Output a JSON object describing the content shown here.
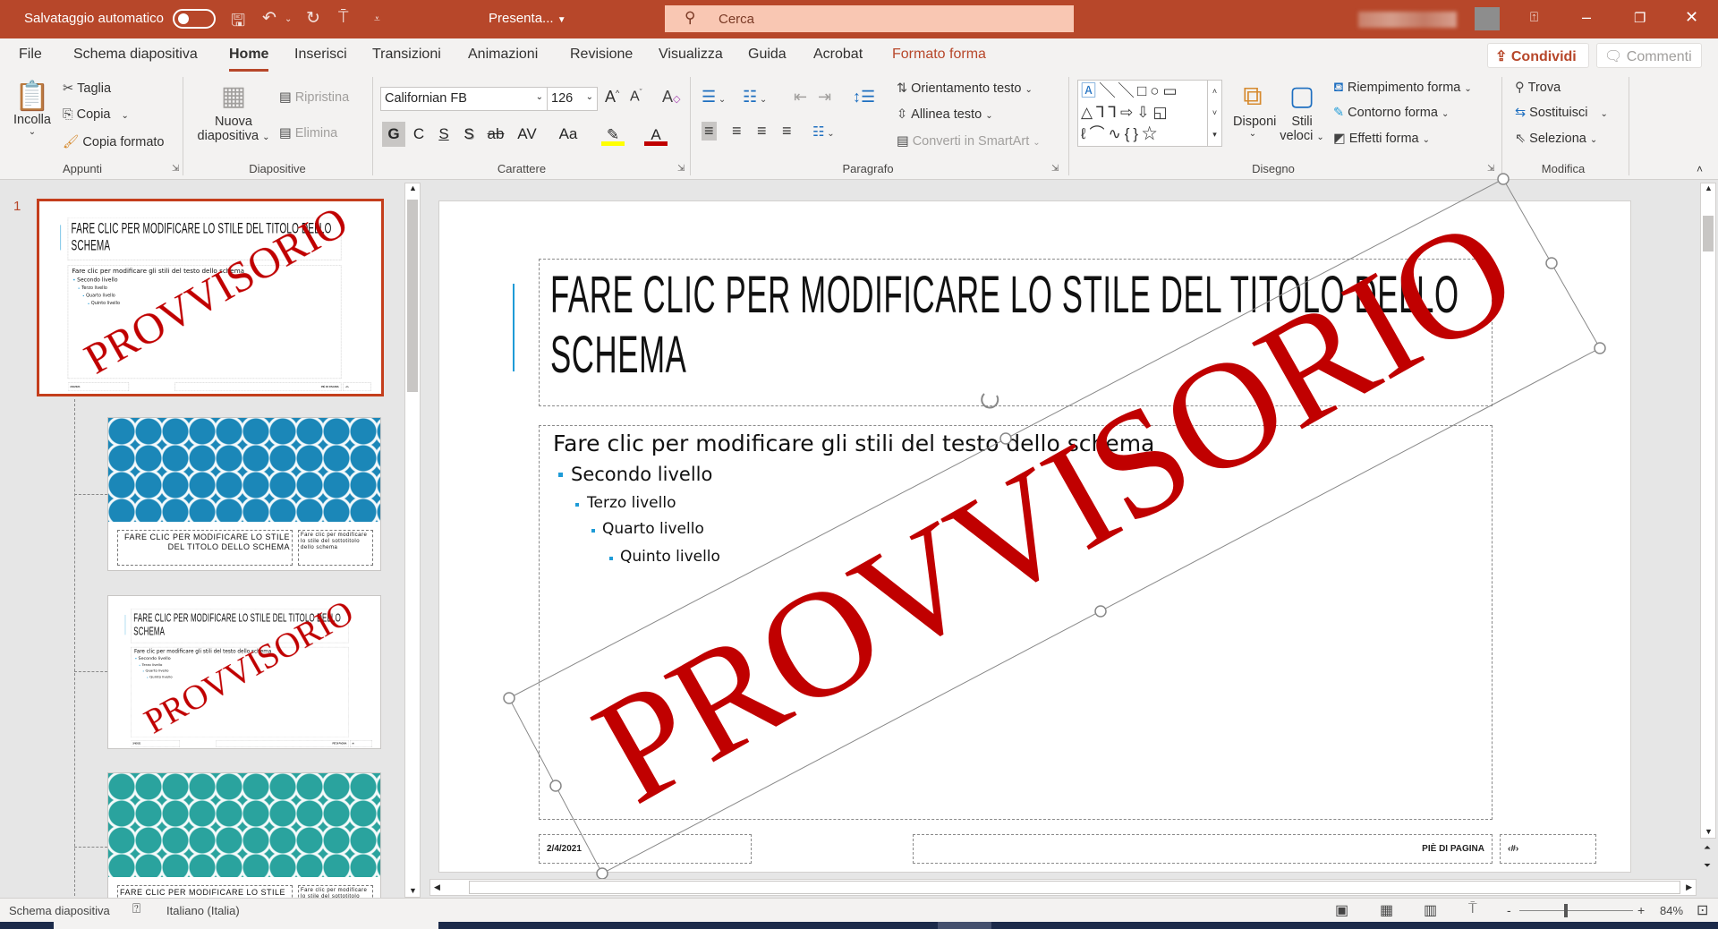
{
  "titlebar": {
    "autosave_label": "Salvataggio automatico",
    "file_name": "Presenta...",
    "search_placeholder": "Cerca",
    "accent": "#b7472a"
  },
  "menu": {
    "tabs": [
      "File",
      "Schema diapositiva",
      "Home",
      "Inserisci",
      "Transizioni",
      "Animazioni",
      "Revisione",
      "Visualizza",
      "Guida",
      "Acrobat",
      "Formato forma"
    ],
    "active": "Home",
    "share": "Condividi",
    "comments": "Commenti"
  },
  "ribbon": {
    "appunti": {
      "label": "Appunti",
      "paste": "Incolla",
      "cut": "Taglia",
      "copy": "Copia",
      "format_painter": "Copia formato"
    },
    "diapositive": {
      "label": "Diapositive",
      "new_slide_1": "Nuova",
      "new_slide_2": "diapositiva",
      "reset": "Ripristina",
      "delete": "Elimina"
    },
    "carattere": {
      "label": "Carattere",
      "font": "Californian FB",
      "size": "126",
      "bold": "G",
      "italic": "C",
      "underline": "S",
      "shadow": "S",
      "strike": "ab",
      "spacing": "AV",
      "case": "Aa"
    },
    "paragrafo": {
      "label": "Paragrafo",
      "text_direction": "Orientamento testo",
      "align_text": "Allinea testo",
      "smartart": "Converti in SmartArt"
    },
    "disegno": {
      "label": "Disegno",
      "arrange": "Disponi",
      "quick_styles_1": "Stili",
      "quick_styles_2": "veloci",
      "fill": "Riempimento forma",
      "outline": "Contorno forma",
      "effects": "Effetti forma"
    },
    "modifica": {
      "label": "Modifica",
      "find": "Trova",
      "replace": "Sostituisci",
      "select": "Seleziona"
    }
  },
  "thumbnails": {
    "selected_number": "1",
    "layout_title": "FARE CLIC PER MODIFICARE LO STILE DEL TITOLO DELLO SCHEMA",
    "layout_title_short": "FARE CLIC PER MODIFICARE LO STILE",
    "layout_text": "Fare clic per modificare lo stile del sottotitolo dello schema",
    "colors": {
      "blue": "#1b87b8",
      "teal": "#2aa39e"
    }
  },
  "slide": {
    "title": "FARE CLIC PER MODIFICARE LO STILE DEL TITOLO DELLO SCHEMA",
    "body": {
      "level1": "Fare clic per modificare gli stili del testo dello schema",
      "level2": "Secondo livello",
      "level3": "Terzo livello",
      "level4": "Quarto livello",
      "level5": "Quinto livello"
    },
    "watermark": "PROVVISORIO",
    "watermark_color": "#c00000",
    "footer_date": "2/4/2021",
    "footer_text": "PIÈ DI PAGINA",
    "footer_number": "‹#›"
  },
  "statusbar": {
    "view_name": "Schema diapositiva",
    "language": "Italiano (Italia)",
    "zoom_minus": "-",
    "zoom_plus": "+",
    "zoom": "84%",
    "zoom_value": 84
  }
}
